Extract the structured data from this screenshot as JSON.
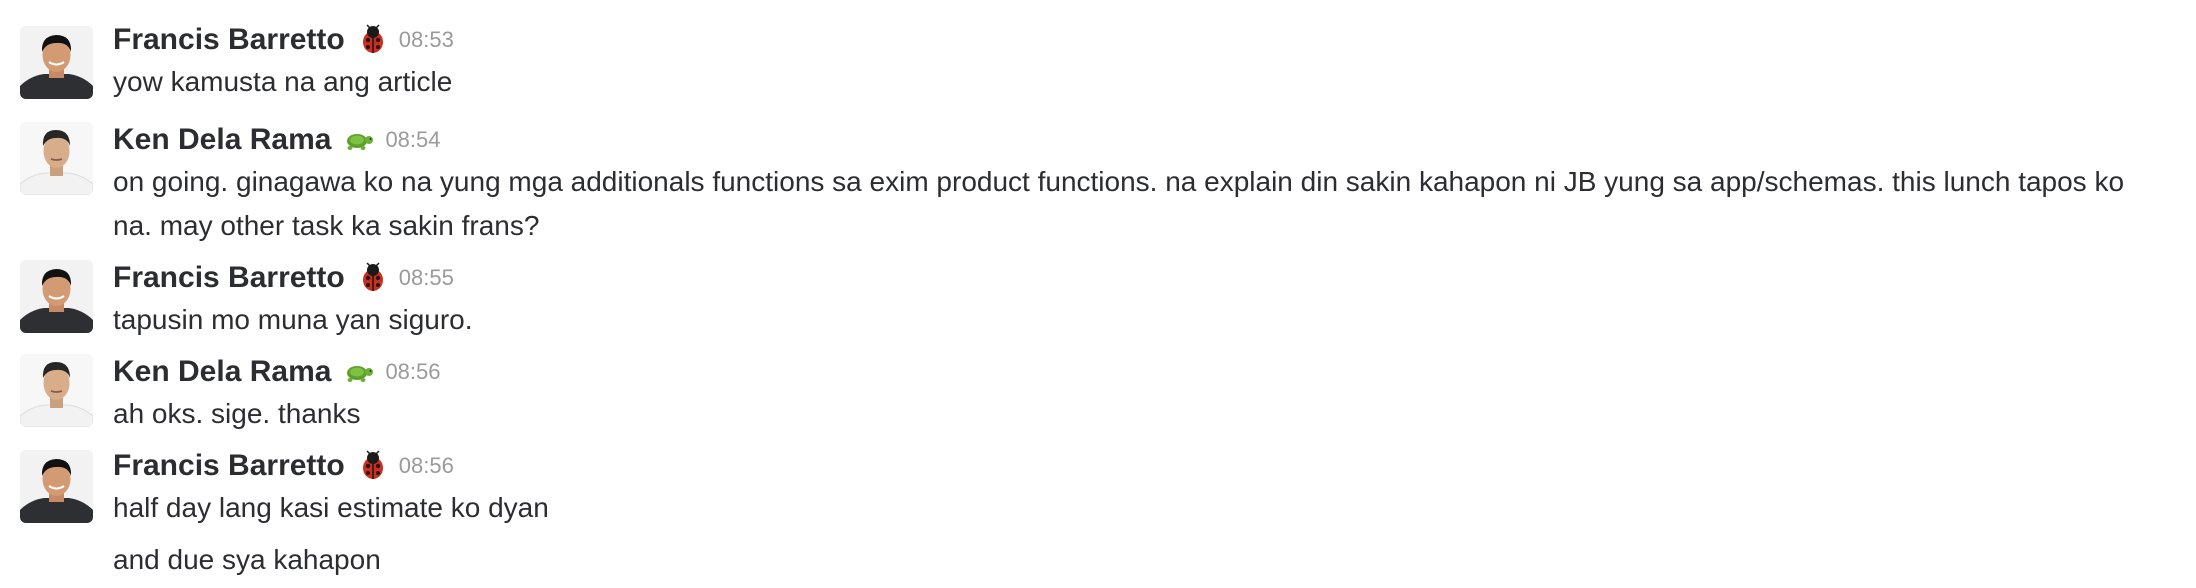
{
  "messages": [
    {
      "author": "Francis Barretto",
      "status_icon": "ladybug-icon",
      "time": "08:53",
      "lines": [
        "yow kamusta na ang article"
      ]
    },
    {
      "author": "Ken Dela Rama",
      "status_icon": "turtle-icon",
      "time": "08:54",
      "lines": [
        "on going. ginagawa ko na yung mga additionals functions sa exim product functions. na explain din sakin kahapon ni JB yung sa app/schemas. this lunch tapos ko na. may other task ka sakin frans?"
      ]
    },
    {
      "author": "Francis Barretto",
      "status_icon": "ladybug-icon",
      "time": "08:55",
      "lines": [
        "tapusin mo muna yan siguro."
      ]
    },
    {
      "author": "Ken Dela Rama",
      "status_icon": "turtle-icon",
      "time": "08:56",
      "lines": [
        "ah oks. sige. thanks"
      ]
    },
    {
      "author": "Francis Barretto",
      "status_icon": "ladybug-icon",
      "time": "08:56",
      "lines": [
        "half day lang kasi estimate ko dyan",
        "and due sya kahapon"
      ]
    }
  ],
  "colors": {
    "text": "#2c2d30",
    "timestamp": "#9a9a9a",
    "background": "#ffffff"
  }
}
